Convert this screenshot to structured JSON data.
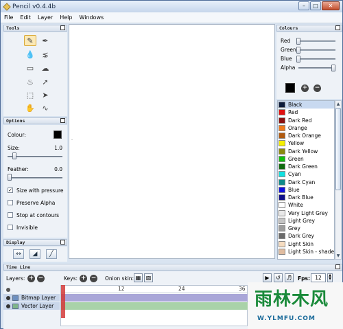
{
  "window": {
    "title": "Pencil v0.4.4b"
  },
  "menu": [
    "File",
    "Edit",
    "Layer",
    "Help",
    "Windows"
  ],
  "tools_panel": {
    "title": "Tools"
  },
  "options_panel": {
    "title": "Options",
    "colour_label": "Colour:",
    "colour_value": "#000000",
    "size_label": "Size:",
    "size_value": "1.0",
    "size_level": 0.1,
    "feather_label": "Feather:",
    "feather_value": "0.0",
    "feather_level": 0.0,
    "checks": [
      {
        "label": "Size with pressure",
        "checked": true
      },
      {
        "label": "Preserve Alpha",
        "checked": false
      },
      {
        "label": "Stop at contours",
        "checked": false
      },
      {
        "label": "Invisible",
        "checked": false
      }
    ]
  },
  "display_panel": {
    "title": "Display"
  },
  "colours_panel": {
    "title": "Colours",
    "channels": [
      {
        "label": "Red",
        "level": 0.0
      },
      {
        "label": "Green",
        "level": 0.0
      },
      {
        "label": "Blue",
        "level": 0.0
      },
      {
        "label": "Alpha",
        "level": 1.0
      }
    ],
    "current_colour": "#000000",
    "list": [
      {
        "name": "Black",
        "color": "#0b1a3a"
      },
      {
        "name": "Red",
        "color": "#e01010"
      },
      {
        "name": "Dark Red",
        "color": "#8a1010"
      },
      {
        "name": "Orange",
        "color": "#f07a1a"
      },
      {
        "name": "Dark Orange",
        "color": "#b05a10"
      },
      {
        "name": "Yellow",
        "color": "#f5f000"
      },
      {
        "name": "Dark Yellow",
        "color": "#8a8a10"
      },
      {
        "name": "Green",
        "color": "#10c010"
      },
      {
        "name": "Dark Green",
        "color": "#106a10"
      },
      {
        "name": "Cyan",
        "color": "#10e0e0"
      },
      {
        "name": "Dark Cyan",
        "color": "#108a8a"
      },
      {
        "name": "Blue",
        "color": "#1010e0"
      },
      {
        "name": "Dark Blue",
        "color": "#10108a"
      },
      {
        "name": "White",
        "color": "#ffffff"
      },
      {
        "name": "Very Light Grey",
        "color": "#e8e8e8"
      },
      {
        "name": "Light Grey",
        "color": "#c4c4c4"
      },
      {
        "name": "Grey",
        "color": "#9c9c9c"
      },
      {
        "name": "Dark Grey",
        "color": "#6a6a6a"
      },
      {
        "name": "Light Skin",
        "color": "#f6dcc0"
      },
      {
        "name": "Light Skin - shade",
        "color": "#e0bca0"
      }
    ]
  },
  "timeline": {
    "title": "Time Line",
    "layers_label": "Layers:",
    "keys_label": "Keys:",
    "onion_label": "Onion skin:",
    "fps_label": "Fps:",
    "fps_value": "12",
    "ruler_ticks": [
      "12",
      "24",
      "36"
    ],
    "layers": [
      {
        "name": "Bitmap Layer"
      },
      {
        "name": "Vector Layer"
      }
    ]
  },
  "watermark": {
    "main": "雨林木风",
    "url": "W.YLMFU.COM"
  }
}
